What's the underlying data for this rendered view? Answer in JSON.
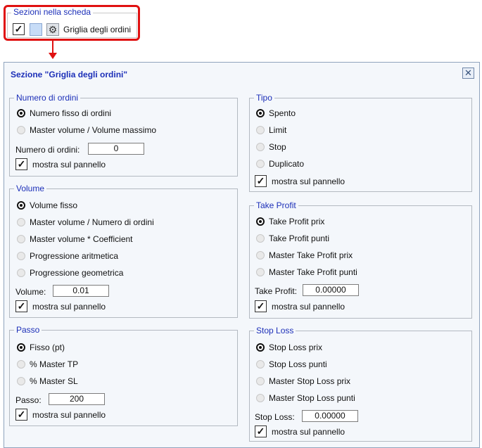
{
  "header": {
    "group_title": "Sezioni nella scheda",
    "visible_checked": "✓",
    "section_label": "Griglia degli ordini",
    "gear_icon_glyph": "⚙"
  },
  "dialog": {
    "title": "Sezione \"Griglia degli ordini\"",
    "close_glyph": "✕"
  },
  "numero_di_ordini": {
    "title": "Numero di ordini",
    "options": [
      "Numero fisso di ordini",
      "Master volume / Volume massimo"
    ],
    "selected": 0,
    "field_label": "Numero di ordini:",
    "field_value": "0",
    "show_label": "mostra sul pannello",
    "show_checked": "✓"
  },
  "volume": {
    "title": "Volume",
    "options": [
      "Volume fisso",
      "Master volume / Numero di ordini",
      "Master volume * Coefficient",
      "Progressione aritmetica",
      "Progressione geometrica"
    ],
    "selected": 0,
    "field_label": "Volume:",
    "field_value": "0.01",
    "show_label": "mostra sul pannello",
    "show_checked": "✓"
  },
  "passo": {
    "title": "Passo",
    "options": [
      "Fisso (pt)",
      "% Master TP",
      "% Master SL"
    ],
    "selected": 0,
    "field_label": "Passo:",
    "field_value": "200",
    "show_label": "mostra sul pannello",
    "show_checked": "✓"
  },
  "tipo": {
    "title": "Tipo",
    "options": [
      "Spento",
      "Limit",
      "Stop",
      "Duplicato"
    ],
    "selected": 0,
    "show_label": "mostra sul pannello",
    "show_checked": "✓"
  },
  "take_profit": {
    "title": "Take Profit",
    "options": [
      "Take Profit prix",
      "Take Profit punti",
      "Master Take Profit prix",
      "Master Take Profit punti"
    ],
    "selected": 0,
    "field_label": "Take Profit:",
    "field_value": "0.00000",
    "show_label": "mostra sul pannello",
    "show_checked": "✓"
  },
  "stop_loss": {
    "title": "Stop Loss",
    "options": [
      "Stop Loss prix",
      "Stop Loss punti",
      "Master Stop Loss prix",
      "Master Stop Loss punti"
    ],
    "selected": 0,
    "field_label": "Stop Loss:",
    "field_value": "0.00000",
    "show_label": "mostra sul pannello",
    "show_checked": "✓"
  },
  "colors": {
    "accent_title": "#1c2fb8",
    "highlight_red": "#e01111",
    "dialog_bg": "#f4f7fb"
  }
}
